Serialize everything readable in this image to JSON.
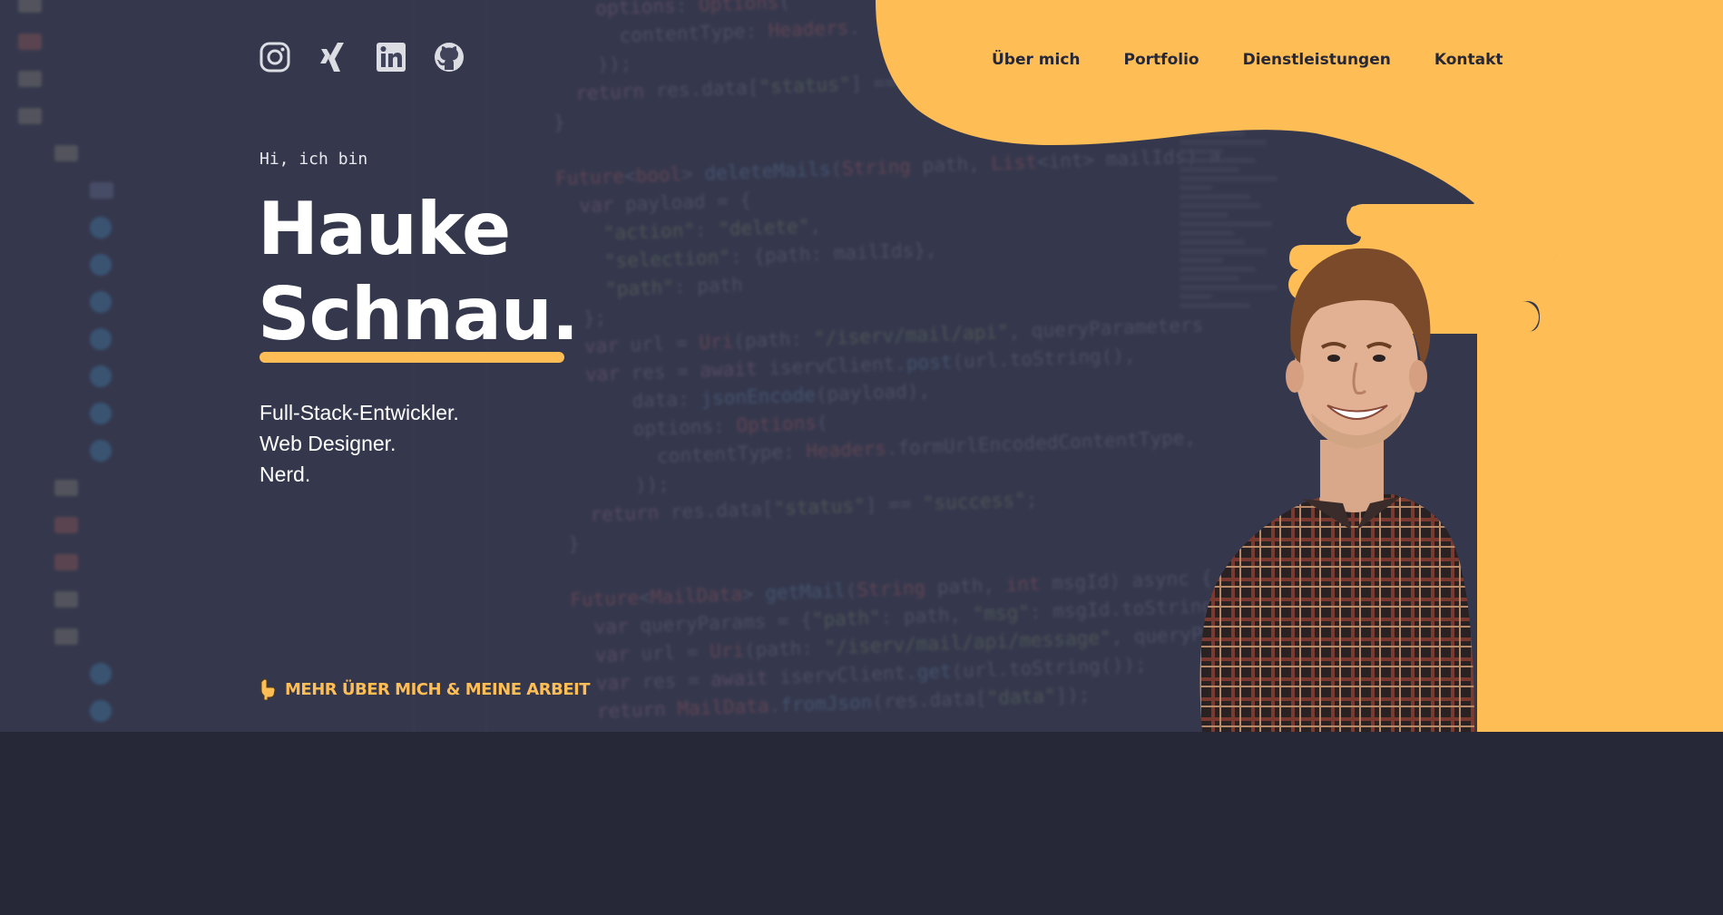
{
  "social": [
    {
      "name": "instagram-icon"
    },
    {
      "name": "xing-icon"
    },
    {
      "name": "linkedin-icon"
    },
    {
      "name": "github-icon"
    }
  ],
  "nav": {
    "items": [
      {
        "label": "Über mich"
      },
      {
        "label": "Portfolio"
      },
      {
        "label": "Dienstleistungen"
      },
      {
        "label": "Kontakt"
      }
    ]
  },
  "hero": {
    "greeting": "Hi, ich bin",
    "name_line1": "Hauke",
    "name_line2": "Schnau.",
    "roles": [
      "Full-Stack-Entwickler.",
      "Web Designer.",
      "Nerd."
    ],
    "cta_label": "MEHR ÜBER MICH & MEINE ARBEIT"
  },
  "colors": {
    "accent": "#ffbe55",
    "dark": "#262837",
    "hero_bg": "#3b3e54"
  }
}
